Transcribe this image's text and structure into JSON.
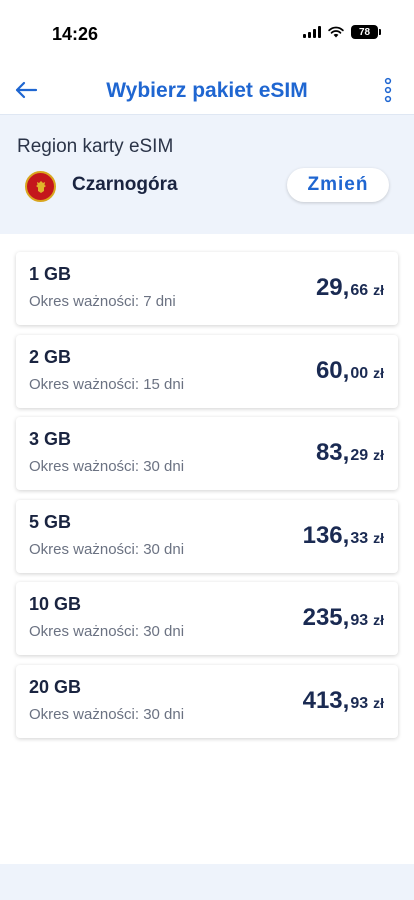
{
  "status_bar": {
    "time": "14:26",
    "battery": "78"
  },
  "header": {
    "title": "Wybierz pakiet eSIM",
    "back_icon": "arrow-left-icon",
    "menu_icon": "more-vertical-icon"
  },
  "region": {
    "label": "Region karty eSIM",
    "country": "Czarnogóra",
    "flag_icon": "montenegro-flag-icon",
    "change_label": "Zmień"
  },
  "packages": [
    {
      "size": "1 GB",
      "validity": "Okres ważności: 7 dni",
      "price_int": "29,",
      "price_dec": "66",
      "currency": "zł"
    },
    {
      "size": "2 GB",
      "validity": "Okres ważności: 15 dni",
      "price_int": "60,",
      "price_dec": "00",
      "currency": "zł"
    },
    {
      "size": "3 GB",
      "validity": "Okres ważności: 30 dni",
      "price_int": "83,",
      "price_dec": "29",
      "currency": "zł"
    },
    {
      "size": "5 GB",
      "validity": "Okres ważności: 30 dni",
      "price_int": "136,",
      "price_dec": "33",
      "currency": "zł"
    },
    {
      "size": "10 GB",
      "validity": "Okres ważności: 30 dni",
      "price_int": "235,",
      "price_dec": "93",
      "currency": "zł"
    },
    {
      "size": "20 GB",
      "validity": "Okres ważności: 30 dni",
      "price_int": "413,",
      "price_dec": "93",
      "currency": "zł"
    }
  ],
  "colors": {
    "accent": "#1f66d1",
    "region_bg": "#eef3fb",
    "text_dark": "#1a2440"
  }
}
